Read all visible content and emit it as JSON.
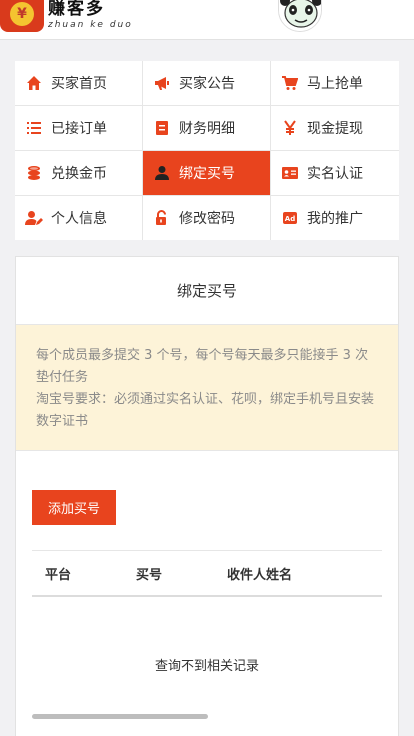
{
  "header": {
    "logo_symbol": "¥",
    "logo_text": "赚客多",
    "logo_pinyin": "zhuan ke duo",
    "avatar_icon": "panda-avatar-icon"
  },
  "menu": {
    "items": [
      {
        "label": "买家首页",
        "icon": "home-icon"
      },
      {
        "label": "买家公告",
        "icon": "megaphone-icon"
      },
      {
        "label": "马上抢单",
        "icon": "cart-icon"
      },
      {
        "label": "已接订单",
        "icon": "list-icon"
      },
      {
        "label": "财务明细",
        "icon": "ledger-icon"
      },
      {
        "label": "现金提现",
        "icon": "yen-icon"
      },
      {
        "label": "兑换金币",
        "icon": "coins-icon"
      },
      {
        "label": "绑定买号",
        "icon": "user-icon",
        "active": true
      },
      {
        "label": "实名认证",
        "icon": "id-card-icon"
      },
      {
        "label": "个人信息",
        "icon": "user-edit-icon"
      },
      {
        "label": "修改密码",
        "icon": "unlock-icon"
      },
      {
        "label": "我的推广",
        "icon": "ad-icon"
      }
    ]
  },
  "card": {
    "title": "绑定买号",
    "notice_line1": "每个成员最多提交 3 个号，每个号每天最多只能接手 3 次垫付任务",
    "notice_line2": "淘宝号要求：必须通过实名认证、花呗，绑定手机号且安装数字证书",
    "add_button": "添加买号",
    "columns": [
      "平台",
      "买号",
      "收件人姓名"
    ],
    "empty_text": "查询不到相关记录"
  },
  "colors": {
    "accent": "#e8441e",
    "notice_bg": "#fdf3d8",
    "page_bg": "#f1f1f3"
  }
}
